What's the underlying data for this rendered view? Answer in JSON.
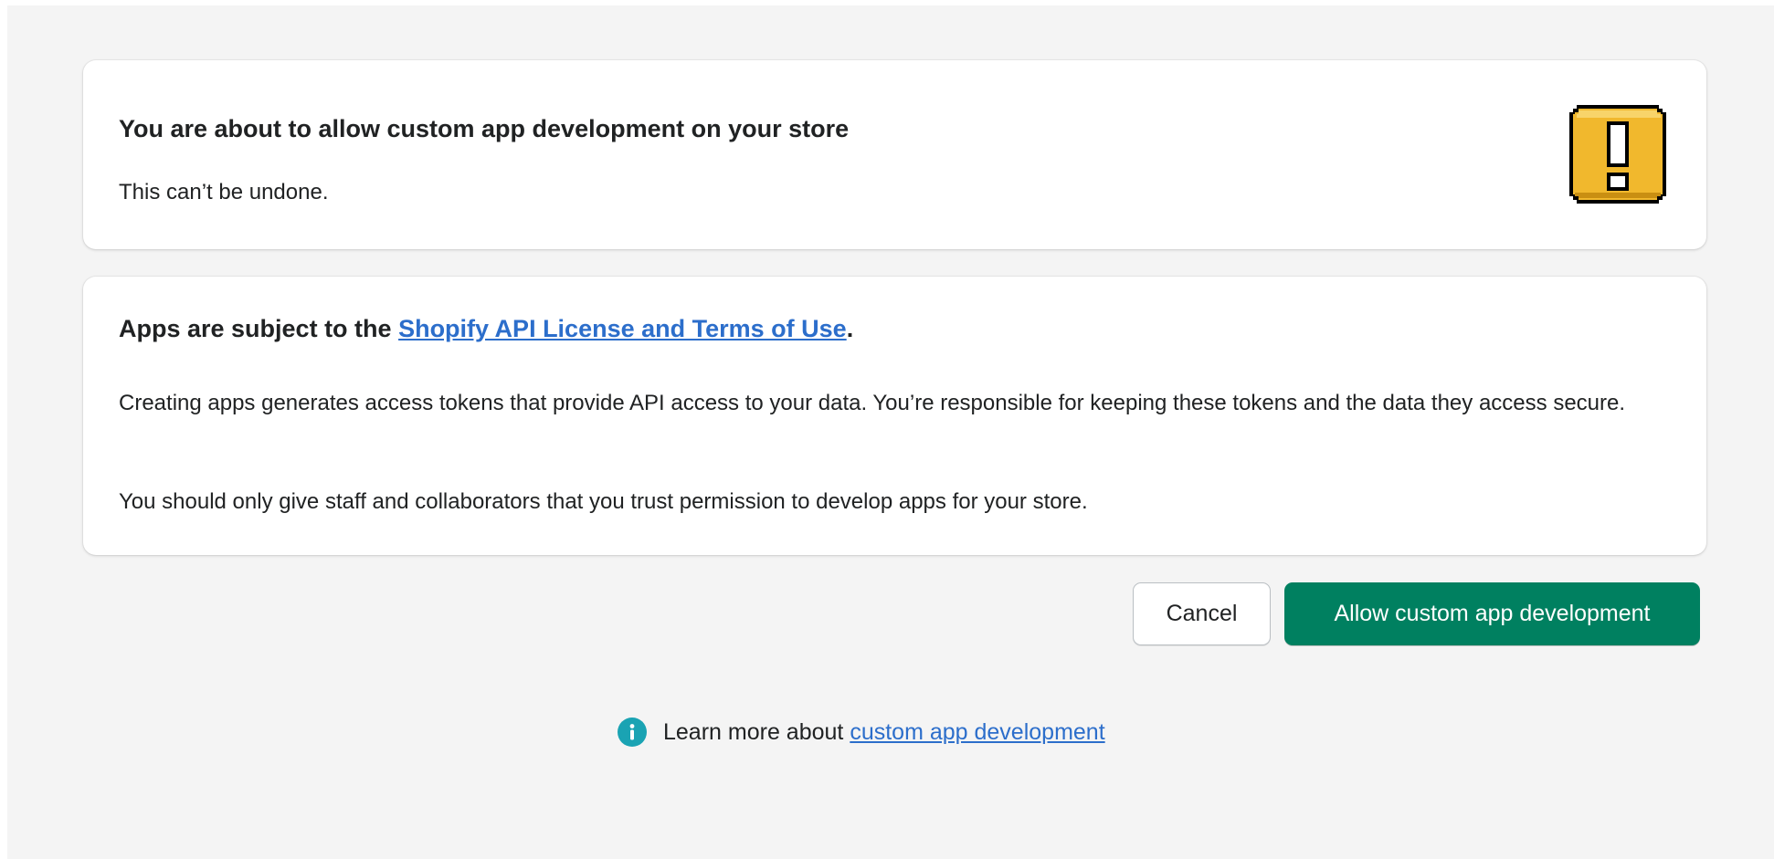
{
  "warning_card": {
    "title": "You are about to allow custom app development on your store",
    "subtitle": "This can’t be undone.",
    "icon": "exclamation-warning-icon",
    "icon_color": "#f1b82d"
  },
  "terms_card": {
    "heading_prefix": "Apps are subject to the ",
    "heading_link": "Shopify API License and Terms of Use",
    "heading_suffix": ".",
    "paragraph_1": "Creating apps generates access tokens that provide API access to your data. You’re responsible for keeping these tokens and the data they access secure.",
    "paragraph_2": "You should only give staff and collaborators that you trust permission to develop apps for your store."
  },
  "actions": {
    "cancel_label": "Cancel",
    "allow_label": "Allow custom app development",
    "primary_color": "#008060"
  },
  "footer": {
    "icon": "info-icon",
    "text_prefix": "Learn more about ",
    "link": "custom app development"
  },
  "colors": {
    "link": "#2c6ecb",
    "info_icon": "#1aa3b3",
    "background": "#f4f4f4"
  }
}
